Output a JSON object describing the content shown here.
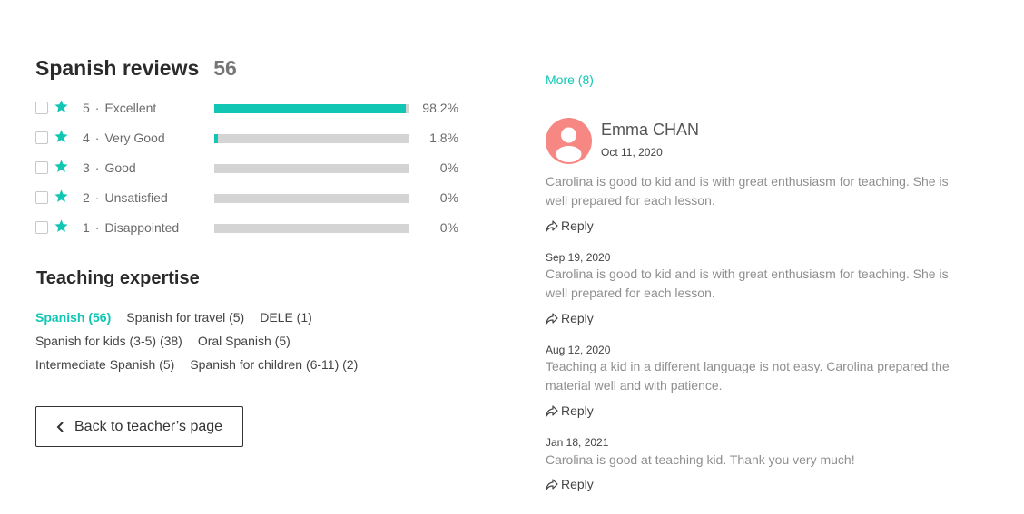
{
  "reviews_header": {
    "title": "Spanish reviews",
    "count": "56"
  },
  "ratings": [
    {
      "num": "5",
      "label": "Excellent",
      "percent": "98.2%",
      "fill": 0.982
    },
    {
      "num": "4",
      "label": "Very Good",
      "percent": "1.8%",
      "fill": 0.018
    },
    {
      "num": "3",
      "label": "Good",
      "percent": "0%",
      "fill": 0
    },
    {
      "num": "2",
      "label": "Unsatisfied",
      "percent": "0%",
      "fill": 0
    },
    {
      "num": "1",
      "label": "Disappointed",
      "percent": "0%",
      "fill": 0
    }
  ],
  "expertise": {
    "title": "Teaching expertise",
    "lines": [
      [
        "Spanish (56)",
        "Spanish for travel (5)",
        "DELE (1)"
      ],
      [
        "Spanish for kids (3-5) (38)",
        "Oral Spanish (5)"
      ],
      [
        "Intermediate Spanish (5)",
        "Spanish for children (6-11) (2)"
      ]
    ],
    "active": "Spanish (56)"
  },
  "back_button": "Back to teacher’s page",
  "more_link": "More (8)",
  "reviewer": {
    "name": "Emma CHAN",
    "date": "Oct 11, 2020"
  },
  "reviews": [
    {
      "date": "",
      "text": "Carolina is good to kid and is with great enthusiasm for teaching. She is well prepared for each lesson.",
      "reply": "Reply"
    },
    {
      "date": "Sep 19, 2020",
      "text": "Carolina is good to kid and is with great enthusiasm for teaching. She is well prepared for each lesson.",
      "reply": "Reply"
    },
    {
      "date": "Aug 12, 2020",
      "text": "Teaching a kid in a different language is not easy. Carolina prepared the material well and with patience.",
      "reply": "Reply"
    },
    {
      "date": "Jan 18, 2021",
      "text": "Carolina is good at teaching kid. Thank you very much!",
      "reply": "Reply"
    }
  ],
  "colors": {
    "accent": "#12c6b4",
    "avatar": "#f78783",
    "bar_bg": "#d4d4d4"
  },
  "icons": {
    "rating": "star-icon",
    "reply": "share-arrow-icon",
    "back": "chevron-left-icon",
    "avatar": "user-icon"
  }
}
